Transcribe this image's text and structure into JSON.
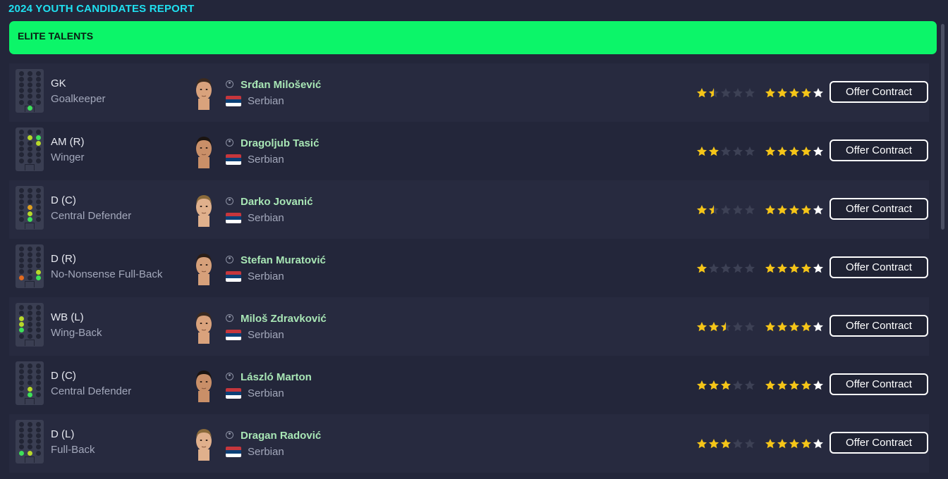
{
  "page": {
    "title": "2024 YOUTH CANDIDATES REPORT"
  },
  "section": {
    "label": "ELITE TALENTS"
  },
  "colors": {
    "accent": "#0cf569",
    "title": "#1fe0f0",
    "name": "#a8e6b5",
    "star": "#f5c518"
  },
  "button_label": "Offer Contract",
  "candidates": [
    {
      "pos_code": "GK",
      "role": "Goalkeeper",
      "name": "Srđan Milošević",
      "nation": "Serbian",
      "current_ability": 1.5,
      "potential_ability": 4.5,
      "pitch_marks": [
        {
          "spot": "gk",
          "color": "#3ee05a"
        }
      ]
    },
    {
      "pos_code": "AM (R)",
      "role": "Winger",
      "name": "Dragoljub Tasić",
      "nation": "Serbian",
      "current_ability": 2,
      "potential_ability": 4.5,
      "pitch_marks": [
        {
          "spot": "amr",
          "color": "#3ee05a"
        },
        {
          "spot": "amc2",
          "color": "#b8d82a"
        },
        {
          "spot": "mr",
          "color": "#b8d82a"
        }
      ]
    },
    {
      "pos_code": "D (C)",
      "role": "Central Defender",
      "name": "Darko Jovanić",
      "nation": "Serbian",
      "current_ability": 1.5,
      "potential_ability": 4.5,
      "pitch_marks": [
        {
          "spot": "dmc",
          "color": "#e0a020"
        },
        {
          "spot": "mc",
          "color": "#b8d82a"
        },
        {
          "spot": "dc",
          "color": "#3ee05a"
        }
      ]
    },
    {
      "pos_code": "D (R)",
      "role": "No-Nonsense Full-Back",
      "name": "Stefan Muratović",
      "nation": "Serbian",
      "current_ability": 1,
      "potential_ability": 4.5,
      "pitch_marks": [
        {
          "spot": "wbr",
          "color": "#b8d82a"
        },
        {
          "spot": "dr",
          "color": "#3ee05a"
        },
        {
          "spot": "dl",
          "color": "#e06a20"
        }
      ]
    },
    {
      "pos_code": "WB (L)",
      "role": "Wing-Back",
      "name": "Miloš Zdravković",
      "nation": "Serbian",
      "current_ability": 2.5,
      "potential_ability": 4.5,
      "pitch_marks": [
        {
          "spot": "ml",
          "color": "#b8d82a"
        },
        {
          "spot": "wbl",
          "color": "#b8d82a"
        },
        {
          "spot": "dl2",
          "color": "#3ee05a"
        }
      ]
    },
    {
      "pos_code": "D (C)",
      "role": "Central Defender",
      "name": "László Marton",
      "nation": "Serbian",
      "current_ability": 3,
      "potential_ability": 4.5,
      "pitch_marks": [
        {
          "spot": "mc",
          "color": "#b8d82a"
        },
        {
          "spot": "dc",
          "color": "#3ee05a"
        }
      ]
    },
    {
      "pos_code": "D (L)",
      "role": "Full-Back",
      "name": "Dragan Radović",
      "nation": "Serbian",
      "current_ability": 3,
      "potential_ability": 4.5,
      "pitch_marks": [
        {
          "spot": "dl",
          "color": "#3ee05a"
        },
        {
          "spot": "dc",
          "color": "#b8d82a"
        }
      ]
    }
  ]
}
